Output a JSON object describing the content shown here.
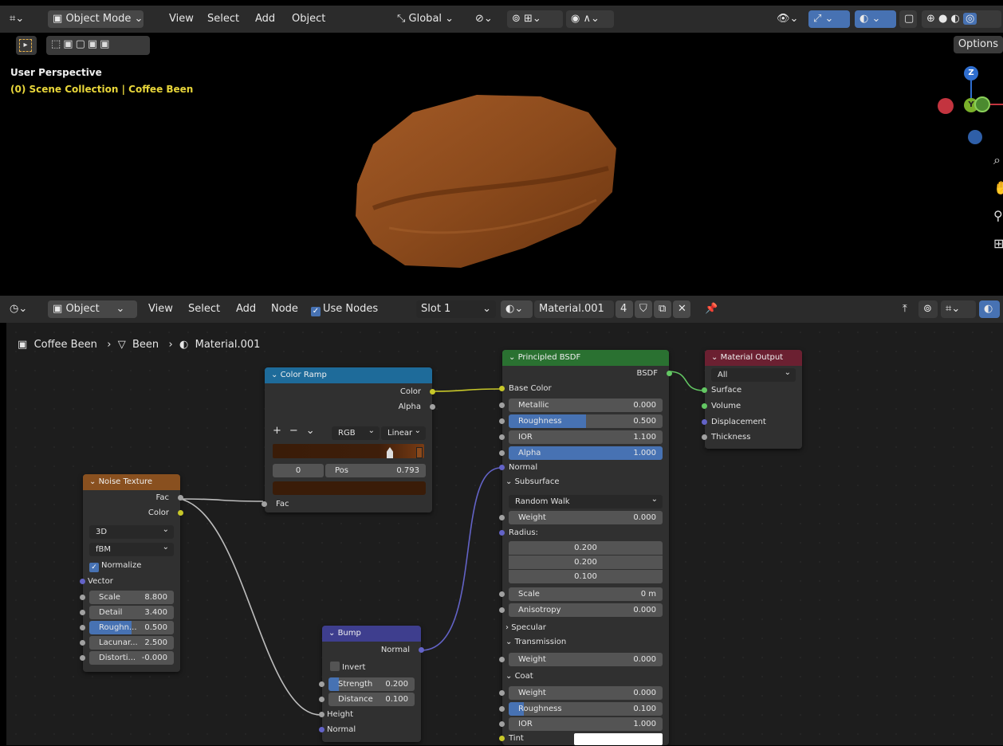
{
  "viewport_header": {
    "mode": "Object Mode",
    "menus": [
      "View",
      "Select",
      "Add",
      "Object"
    ],
    "transform_orientation": "Global",
    "options": "Options"
  },
  "viewport": {
    "perspective": "User Perspective",
    "collection": "(0) Scene Collection | Coffee Been",
    "gizmo": {
      "z": "Z",
      "y": "Y"
    }
  },
  "node_header": {
    "object_mode": "Object",
    "menus": [
      "View",
      "Select",
      "Add",
      "Node"
    ],
    "use_nodes": "Use Nodes",
    "slot": "Slot 1",
    "material": "Material.001",
    "users": "4"
  },
  "breadcrumb": {
    "object": "Coffee Been",
    "mesh": "Been",
    "material": "Material.001"
  },
  "colors": {
    "color_ramp_header": "#1e6b9a",
    "noise_header": "#89501f",
    "bsdf_header": "#2a7131",
    "output_header": "#6b2031",
    "bump_header": "#3e3e8e",
    "accent": "#4772b3",
    "bean": "#8b4a1c"
  },
  "nodes": {
    "color_ramp": {
      "title": "Color Ramp",
      "out_color": "Color",
      "out_alpha": "Alpha",
      "color_mode": "RGB",
      "interpolation": "Linear",
      "stop_index": "0",
      "pos_label": "Pos",
      "pos_value": "0.793",
      "in_fac": "Fac"
    },
    "noise": {
      "title": "Noise Texture",
      "out_fac": "Fac",
      "out_color": "Color",
      "dimensions": "3D",
      "type": "fBM",
      "normalize": "Normalize",
      "vector": "Vector",
      "fields": [
        {
          "label": "Scale",
          "value": "8.800",
          "fill": 0
        },
        {
          "label": "Detail",
          "value": "3.400",
          "fill": 0
        },
        {
          "label": "Roughn...",
          "value": "0.500",
          "fill": 0.5
        },
        {
          "label": "Lacunar...",
          "value": "2.500",
          "fill": 0
        },
        {
          "label": "Distorti...",
          "value": "-0.000",
          "fill": 0
        }
      ]
    },
    "bump": {
      "title": "Bump",
      "out_normal": "Normal",
      "invert": "Invert",
      "strength_label": "Strength",
      "strength": "0.200",
      "distance_label": "Distance",
      "distance": "0.100",
      "in_height": "Height",
      "in_normal": "Normal"
    },
    "bsdf": {
      "title": "Principled BSDF",
      "out": "BSDF",
      "base_color": "Base Color",
      "metallic": {
        "label": "Metallic",
        "value": "0.000",
        "fill": 0
      },
      "roughness": {
        "label": "Roughness",
        "value": "0.500",
        "fill": 0.5
      },
      "ior": {
        "label": "IOR",
        "value": "1.100",
        "fill": 0
      },
      "alpha": {
        "label": "Alpha",
        "value": "1.000",
        "fill": 1
      },
      "normal": "Normal",
      "subsurface": "Subsurface",
      "subsurface_method": "Random Walk",
      "ss_weight": {
        "label": "Weight",
        "value": "0.000"
      },
      "radius": "Radius:",
      "radius_values": [
        "0.200",
        "0.200",
        "0.100"
      ],
      "ss_scale": {
        "label": "Scale",
        "value": "0 m"
      },
      "anisotropy": {
        "label": "Anisotropy",
        "value": "0.000"
      },
      "specular": "Specular",
      "transmission": "Transmission",
      "tr_weight": {
        "label": "Weight",
        "value": "0.000"
      },
      "coat": "Coat",
      "coat_weight": {
        "label": "Weight",
        "value": "0.000"
      },
      "coat_roughness": {
        "label": "Roughness",
        "value": "0.100",
        "fill": 0.1
      },
      "coat_ior": {
        "label": "IOR",
        "value": "1.000"
      },
      "tint": "Tint"
    },
    "output": {
      "title": "Material Output",
      "target": "All",
      "surface": "Surface",
      "volume": "Volume",
      "displacement": "Displacement",
      "thickness": "Thickness"
    }
  }
}
